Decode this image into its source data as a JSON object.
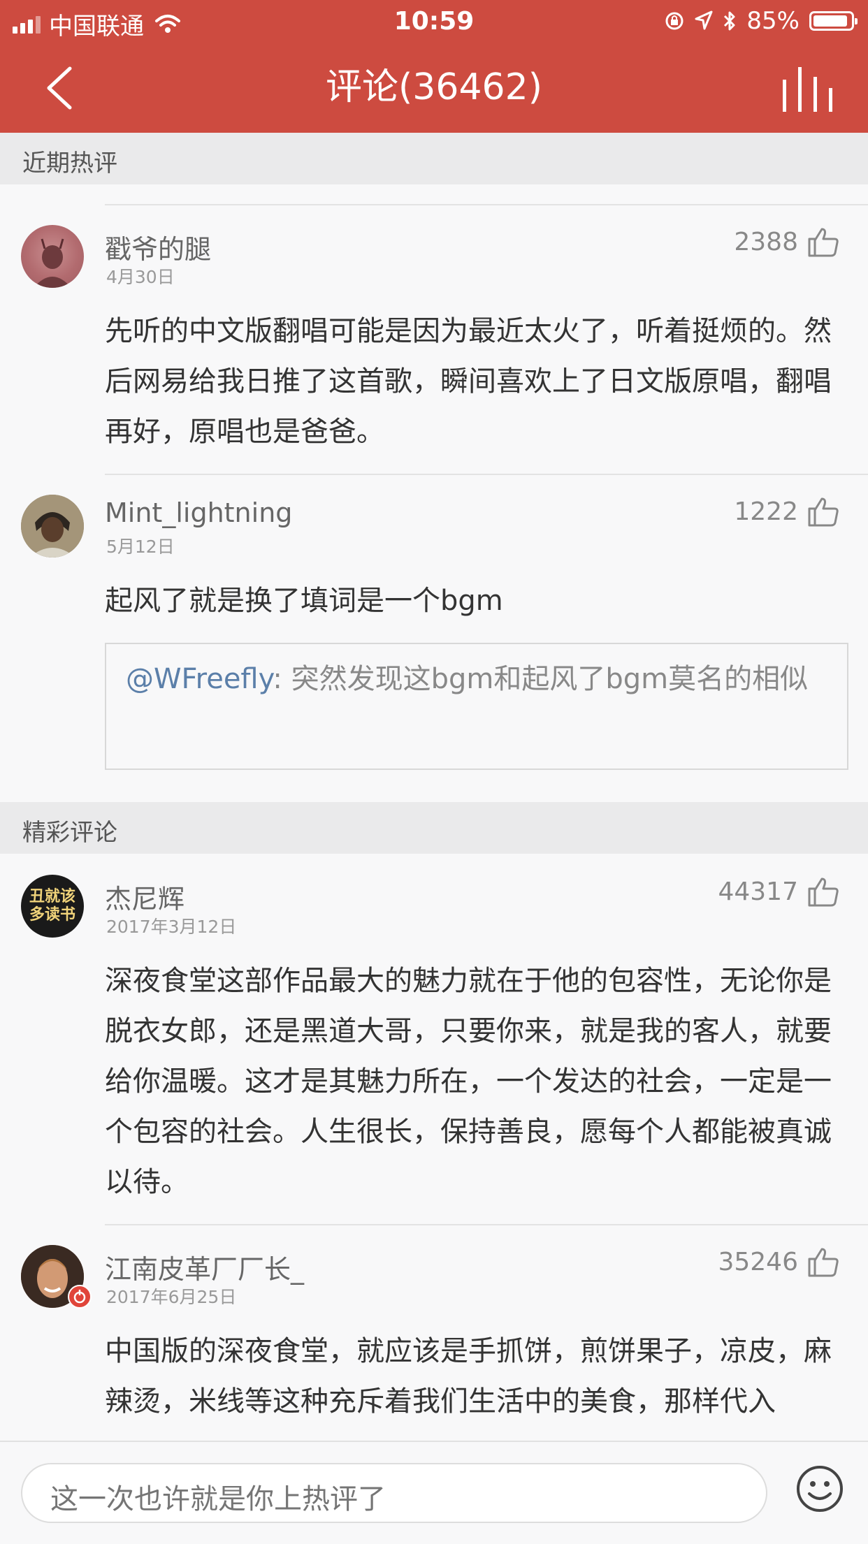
{
  "status": {
    "carrier": "中国联通",
    "time": "10:59",
    "battery": "85%"
  },
  "header": {
    "title": "评论(36462)"
  },
  "sections": {
    "recent_hot": "近期热评",
    "featured": "精彩评论"
  },
  "comments": [
    {
      "name": "戳爷的腿",
      "date": "4月30日",
      "likes": "2388",
      "content": "先听的中文版翻唱可能是因为最近太火了，听着挺烦的。然后网易给我日推了这首歌，瞬间喜欢上了日文版原唱，翻唱再好，原唱也是爸爸。"
    },
    {
      "name": "Mint_lightning",
      "date": "5月12日",
      "likes": "1222",
      "content": "起风了就是换了填词是一个bgm",
      "reply": {
        "user": "@WFreefly",
        "text": ": 突然发现这bgm和起风了bgm莫名的相似"
      }
    },
    {
      "name": "杰尼辉",
      "date": "2017年3月12日",
      "likes": "44317",
      "avatar_text": [
        "丑就该",
        "多读书"
      ],
      "content": "深夜食堂这部作品最大的魅力就在于他的包容性，无论你是脱衣女郎，还是黑道大哥，只要你来，就是我的客人，就要给你温暖。这才是其魅力所在，一个发达的社会，一定是一个包容的社会。人生很长，保持善良，愿每个人都能被真诚以待。"
    },
    {
      "name": "江南皮革厂厂长_",
      "date": "2017年6月25日",
      "likes": "35246",
      "content": "中国版的深夜食堂，就应该是手抓饼，煎饼果子，凉皮，麻辣烫，米线等这种充斥着我们生活中的美食，那样代入"
    }
  ],
  "input": {
    "placeholder": "这一次也许就是你上热评了"
  },
  "colors": {
    "brand": "#cd4b40",
    "link": "#5b7fa9"
  }
}
